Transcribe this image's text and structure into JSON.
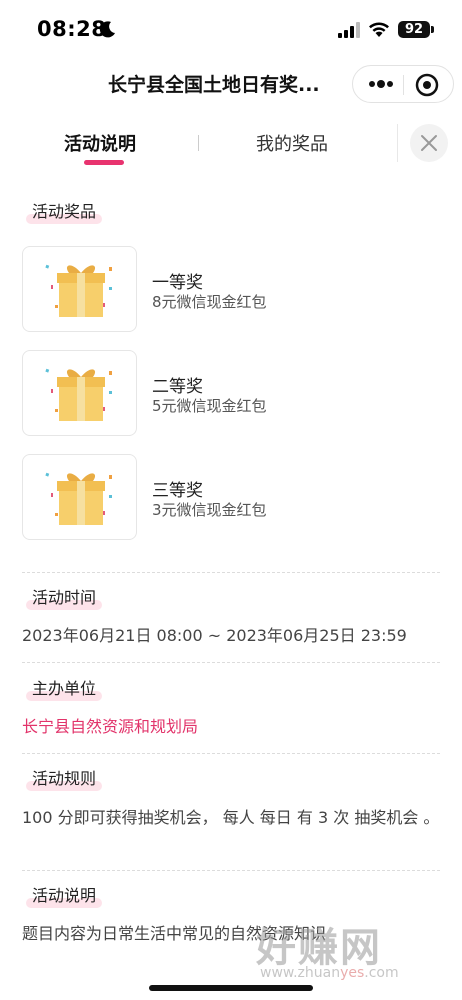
{
  "status_bar": {
    "time": "08:28",
    "battery": "92"
  },
  "nav": {
    "title": "长宁县全国土地日有奖..."
  },
  "tabs": [
    {
      "label": "活动说明",
      "active": true
    },
    {
      "label": "我的奖品",
      "active": false
    }
  ],
  "sections": {
    "prizes": {
      "label": "活动奖品",
      "items": [
        {
          "name": "一等奖",
          "desc": "8元微信现金红包"
        },
        {
          "name": "二等奖",
          "desc": "5元微信现金红包"
        },
        {
          "name": "三等奖",
          "desc": "3元微信现金红包"
        }
      ]
    },
    "time": {
      "label": "活动时间",
      "value": "2023年06月21日 08:00 ~ 2023年06月25日 23:59"
    },
    "organizer": {
      "label": "主办单位",
      "value": "长宁县自然资源和规划局"
    },
    "rules": {
      "label": "活动规则",
      "value": "100 分即可获得抽奖机会， 每人 每日 有 3 次 抽奖机会 。"
    },
    "desc": {
      "label": "活动说明",
      "value": "题目内容为日常生活中常见的自然资源知识"
    }
  },
  "watermark": {
    "big": "好赚网",
    "small_prefix": "www.zhuan",
    "small_highlight": "yes",
    "small_suffix": ".com"
  },
  "colors": {
    "accent": "#e8336f",
    "highlight": "#fde3ea",
    "organizer_text": "#e2336a"
  }
}
